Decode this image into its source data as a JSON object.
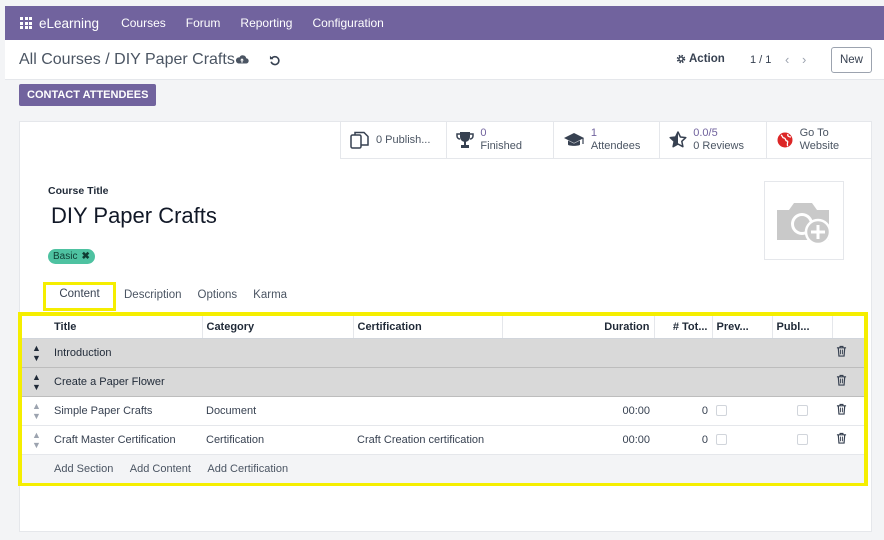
{
  "app": {
    "name": "eLearning",
    "menu": [
      "Courses",
      "Forum",
      "Reporting",
      "Configuration"
    ]
  },
  "control": {
    "breadcrumb_parent": "All Courses",
    "breadcrumb_sep": "/",
    "breadcrumb_current": "DIY Paper Crafts",
    "action_label": "Action",
    "pager": "1 / 1",
    "new_label": "New"
  },
  "status": {
    "contact_label": "CONTACT ATTENDEES"
  },
  "smart_buttons": [
    {
      "value": "",
      "label": "0 Publish...",
      "icon": "files-icon"
    },
    {
      "value": "0",
      "label": "Finished",
      "icon": "trophy-icon"
    },
    {
      "value": "1",
      "label": "Attendees",
      "icon": "graduation-cap-icon"
    },
    {
      "value": "0.0/5",
      "label": "0 Reviews",
      "icon": "star-half-icon"
    },
    {
      "value": "Go To",
      "label": "Website",
      "icon": "globe-icon"
    }
  ],
  "form": {
    "title_label": "Course Title",
    "title_value": "DIY Paper Crafts",
    "tag": "Basic"
  },
  "tabs": [
    "Content",
    "Description",
    "Options",
    "Karma"
  ],
  "content_table": {
    "headers": [
      "Title",
      "Category",
      "Certification",
      "Duration",
      "# Tot...",
      "Prev...",
      "Publ..."
    ],
    "rows": [
      {
        "type": "section",
        "title": "Introduction"
      },
      {
        "type": "section",
        "title": "Create a Paper Flower"
      },
      {
        "type": "line",
        "title": "Simple Paper Crafts",
        "category": "Document",
        "certification": "",
        "duration": "00:00",
        "total": "0"
      },
      {
        "type": "line",
        "title": "Craft Master Certification",
        "category": "Certification",
        "certification": "Craft Creation certification",
        "duration": "00:00",
        "total": "0"
      }
    ],
    "add_links": [
      "Add Section",
      "Add Content",
      "Add Certification"
    ]
  },
  "colors": {
    "brand": "#71639e",
    "highlight": "#f5ee00",
    "tag": "#4ec2a1"
  }
}
